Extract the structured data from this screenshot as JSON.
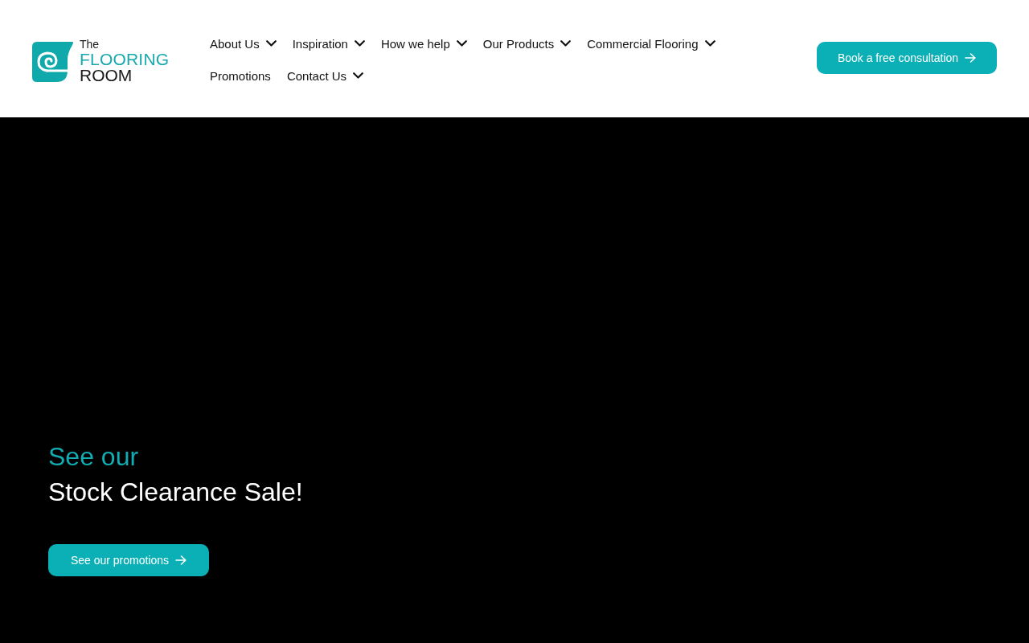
{
  "header": {
    "logo": {
      "line_1": "The",
      "line_2": "FLOORING",
      "line_3": "ROOM"
    },
    "nav": [
      {
        "label": "About Us",
        "dropdown": true
      },
      {
        "label": "Inspiration",
        "dropdown": true
      },
      {
        "label": "How we help",
        "dropdown": true
      },
      {
        "label": "Our Products",
        "dropdown": true
      },
      {
        "label": "Commercial Flooring",
        "dropdown": true
      },
      {
        "label": "Promotions",
        "dropdown": false
      },
      {
        "label": "Contact Us",
        "dropdown": true
      }
    ],
    "cta_button": {
      "label": "Book a free consultation"
    }
  },
  "hero": {
    "eyebrow": "See our",
    "title": "Stock Clearance Sale!",
    "button": {
      "label": "See our promotions"
    }
  }
}
